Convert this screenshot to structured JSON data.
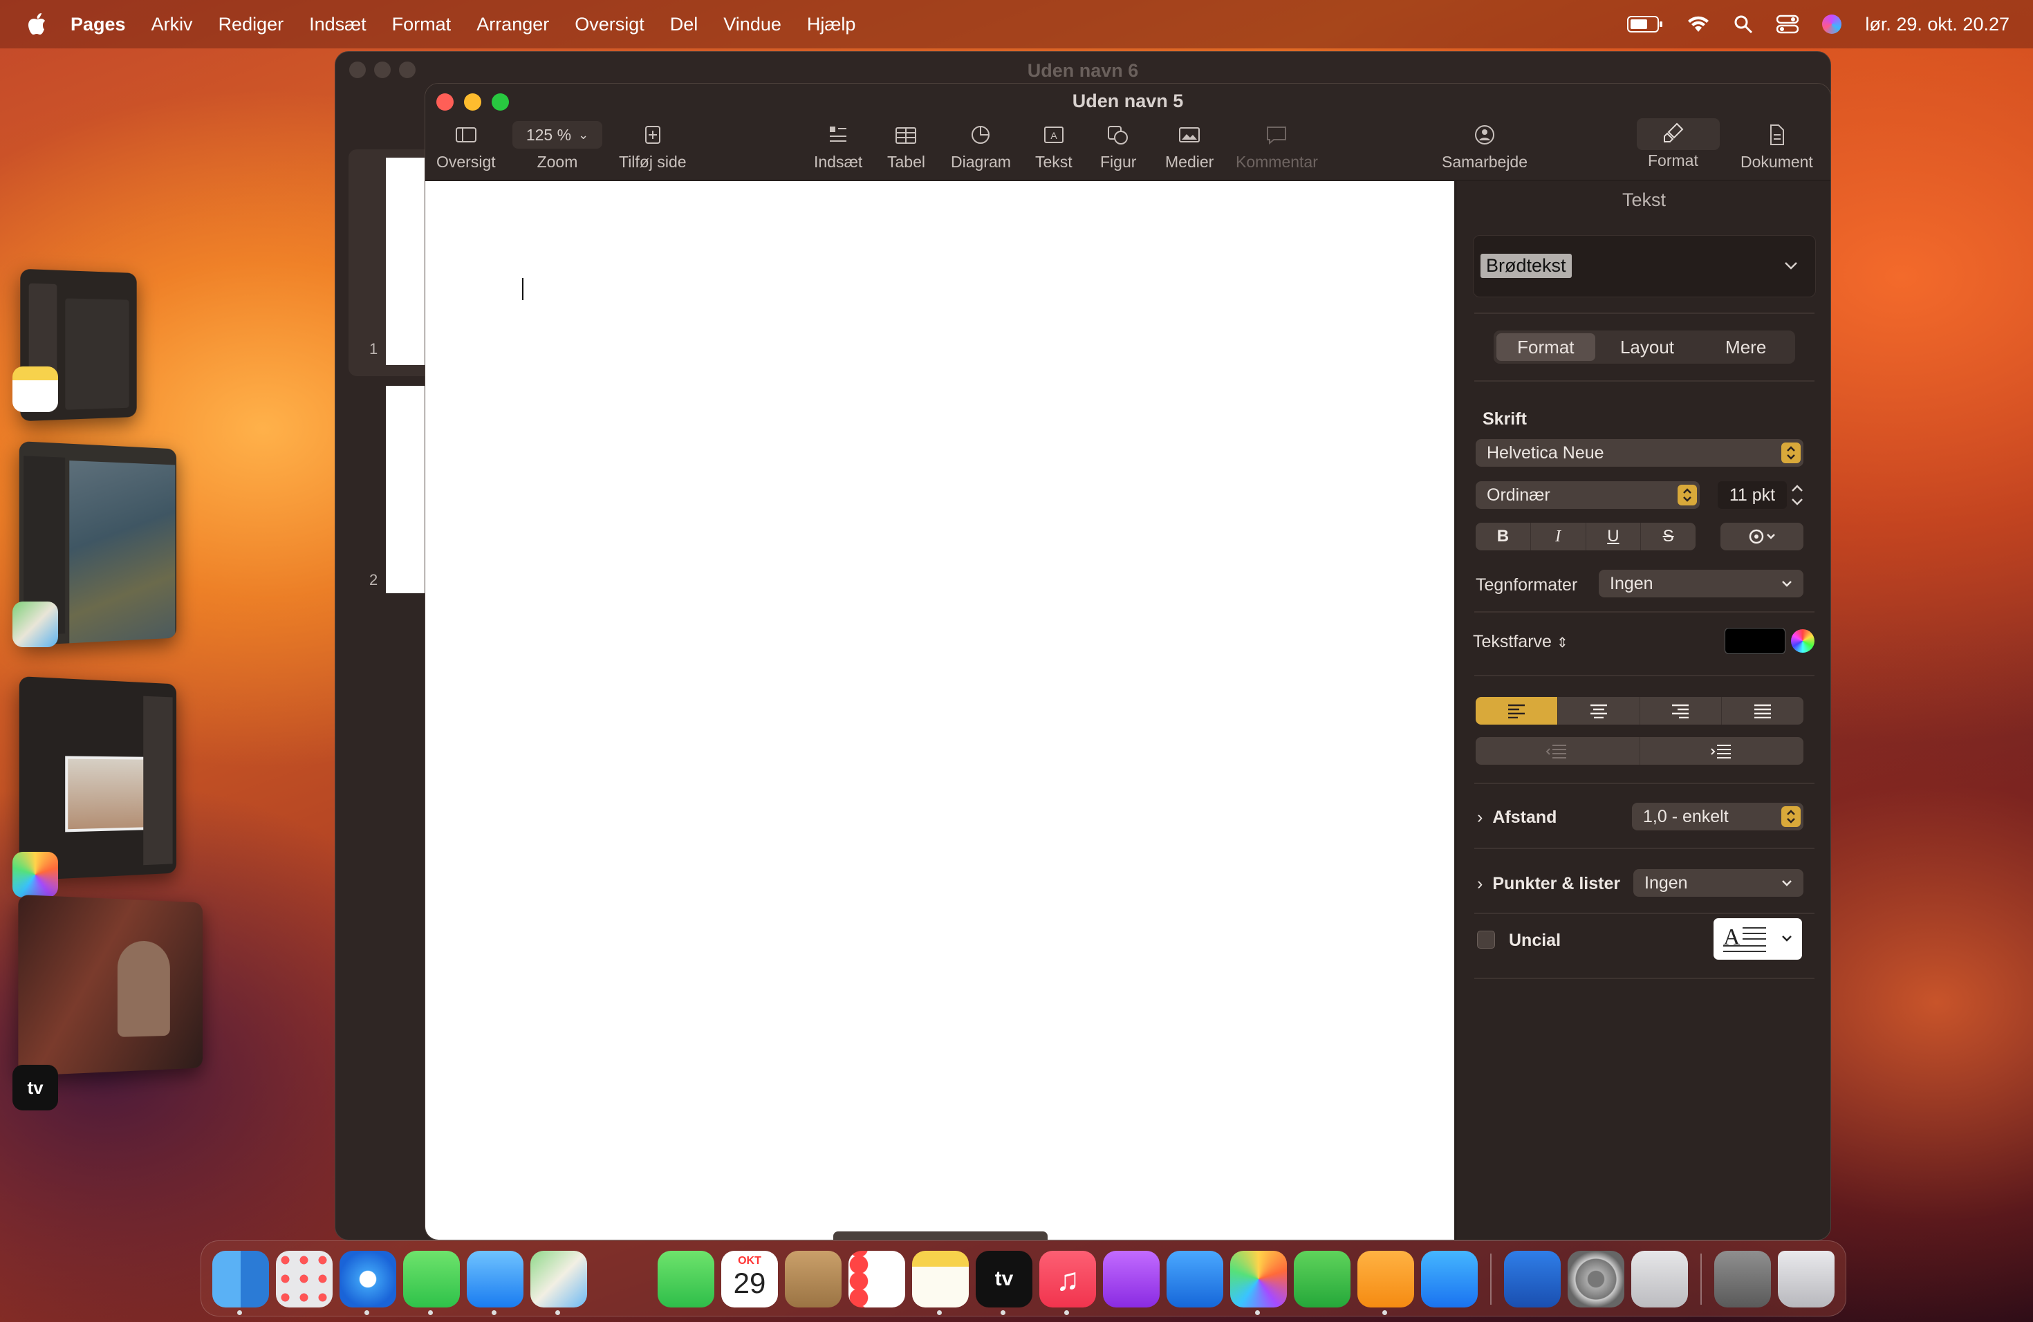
{
  "menubar": {
    "app_name": "Pages",
    "items": [
      "Arkiv",
      "Rediger",
      "Indsæt",
      "Format",
      "Arranger",
      "Oversigt",
      "Del",
      "Vindue",
      "Hjælp"
    ],
    "clock": "lør. 29. okt. 20.27"
  },
  "back_window": {
    "title": "Uden navn 6",
    "page_numbers": [
      "1",
      "2"
    ]
  },
  "window": {
    "title": "Uden navn 5",
    "toolbar": {
      "oversigt": "Oversigt",
      "zoom_value": "125 %",
      "zoom": "Zoom",
      "add_page": "Tilføj side",
      "insert": "Indsæt",
      "table": "Tabel",
      "chart": "Diagram",
      "text": "Tekst",
      "shape": "Figur",
      "media": "Medier",
      "comment": "Kommentar",
      "collaborate": "Samarbejde",
      "format": "Format",
      "document": "Dokument"
    }
  },
  "sidebar": {
    "header": "Tekst",
    "paragraph_style": "Brødtekst",
    "tabs": [
      "Format",
      "Layout",
      "Mere"
    ],
    "font_section": "Skrift",
    "font_family": "Helvetica Neue",
    "font_style": "Ordinær",
    "font_size": "11 pkt",
    "style_buttons": [
      "B",
      "I",
      "U",
      "S"
    ],
    "char_styles_label": "Tegnformater",
    "char_styles_value": "Ingen",
    "text_color_label": "Tekstfarve",
    "text_color": "#000000",
    "spacing_label": "Afstand",
    "spacing_value": "1,0 - enkelt",
    "bullets_label": "Punkter & lister",
    "bullets_value": "Ingen",
    "dropcap_label": "Uncial"
  },
  "dock": {
    "calendar_month": "OKT",
    "calendar_day": "29"
  },
  "colors": {
    "accent": "#d9a93a"
  }
}
